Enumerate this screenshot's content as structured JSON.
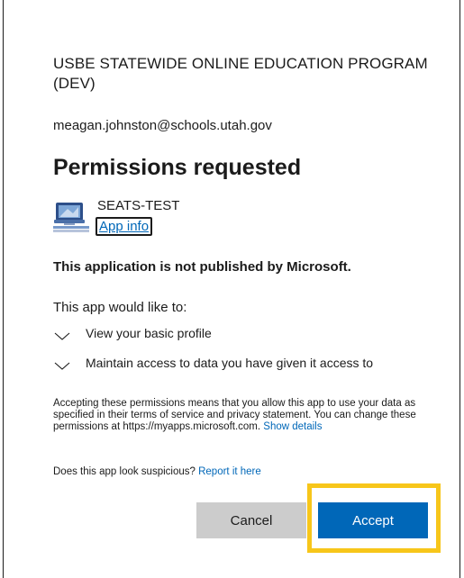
{
  "organization": "USBE STATEWIDE ONLINE EDUCATION PROGRAM (DEV)",
  "account_email": "meagan.johnston@schools.utah.gov",
  "heading": "Permissions requested",
  "app": {
    "name": "SEATS-TEST",
    "info_link": "App info",
    "logo_icon": "statewide-online-education-logo"
  },
  "publisher_notice": "This application is not published by Microsoft.",
  "intro": "This app would like to:",
  "permissions": [
    {
      "label": "View your basic profile"
    },
    {
      "label": "Maintain access to data you have given it access to"
    }
  ],
  "fineprint": {
    "text": "Accepting these permissions means that you allow this app to use your data as specified in their terms of service and privacy statement. You can change these permissions at https://myapps.microsoft.com.",
    "show_details": "Show details"
  },
  "suspicious": {
    "question": "Does this app look suspicious?",
    "report_link": "Report it here"
  },
  "buttons": {
    "cancel": "Cancel",
    "accept": "Accept"
  },
  "colors": {
    "accent": "#0067b8",
    "cancel_bg": "#cccccc",
    "highlight": "#f7c61a"
  }
}
